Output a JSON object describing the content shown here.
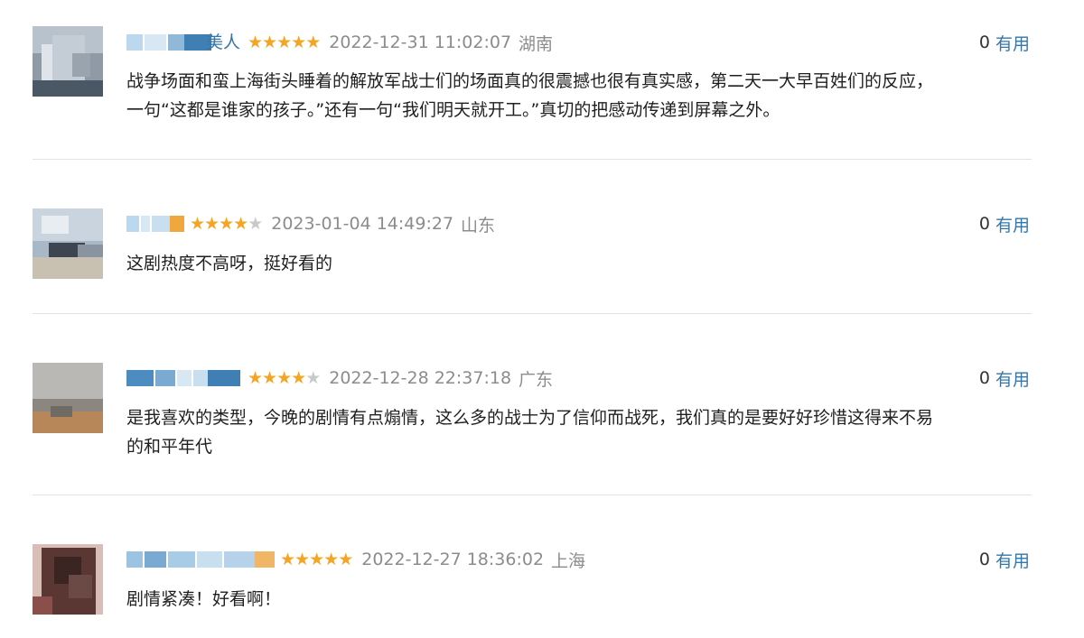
{
  "reviews": [
    {
      "username_visible": "美人",
      "rating": 5,
      "timestamp": "2022-12-31 11:02:07",
      "location": "湖南",
      "useful_count": "0",
      "useful_label": "有用",
      "content_line1": "战争场面和蛮上海街头睡着的解放军战士们的场面真的很震撼也很有真实感，第二天一大早百姓们的反应，",
      "content_line2": "一句“这都是谁家的孩子。”还有一句“我们明天就开工。”真切的把感动传递到屏幕之外。"
    },
    {
      "username_visible": "",
      "rating": 4,
      "timestamp": "2023-01-04 14:49:27",
      "location": "山东",
      "useful_count": "0",
      "useful_label": "有用",
      "content_line1": "这剧热度不高呀，挺好看的",
      "content_line2": ""
    },
    {
      "username_visible": "",
      "rating": 4,
      "timestamp": "2022-12-28 22:37:18",
      "location": "广东",
      "useful_count": "0",
      "useful_label": "有用",
      "content_line1": "是我喜欢的类型，今晚的剧情有点煽情，这么多的战士为了信仰而战死，我们真的是要好好珍惜这得来不易",
      "content_line2": "的和平年代"
    },
    {
      "username_visible": "",
      "rating": 5,
      "timestamp": "2022-12-27 18:36:02",
      "location": "上海",
      "useful_count": "0",
      "useful_label": "有用",
      "content_line1": "剧情紧凑！好看啊！",
      "content_line2": ""
    }
  ],
  "colors": {
    "star_on": "#f4a623",
    "star_off": "#c9c9c9",
    "link_blue": "#3377aa",
    "meta_gray": "#8c8c8c"
  },
  "icons": {
    "star": "star-icon",
    "avatar": "user-avatar"
  }
}
